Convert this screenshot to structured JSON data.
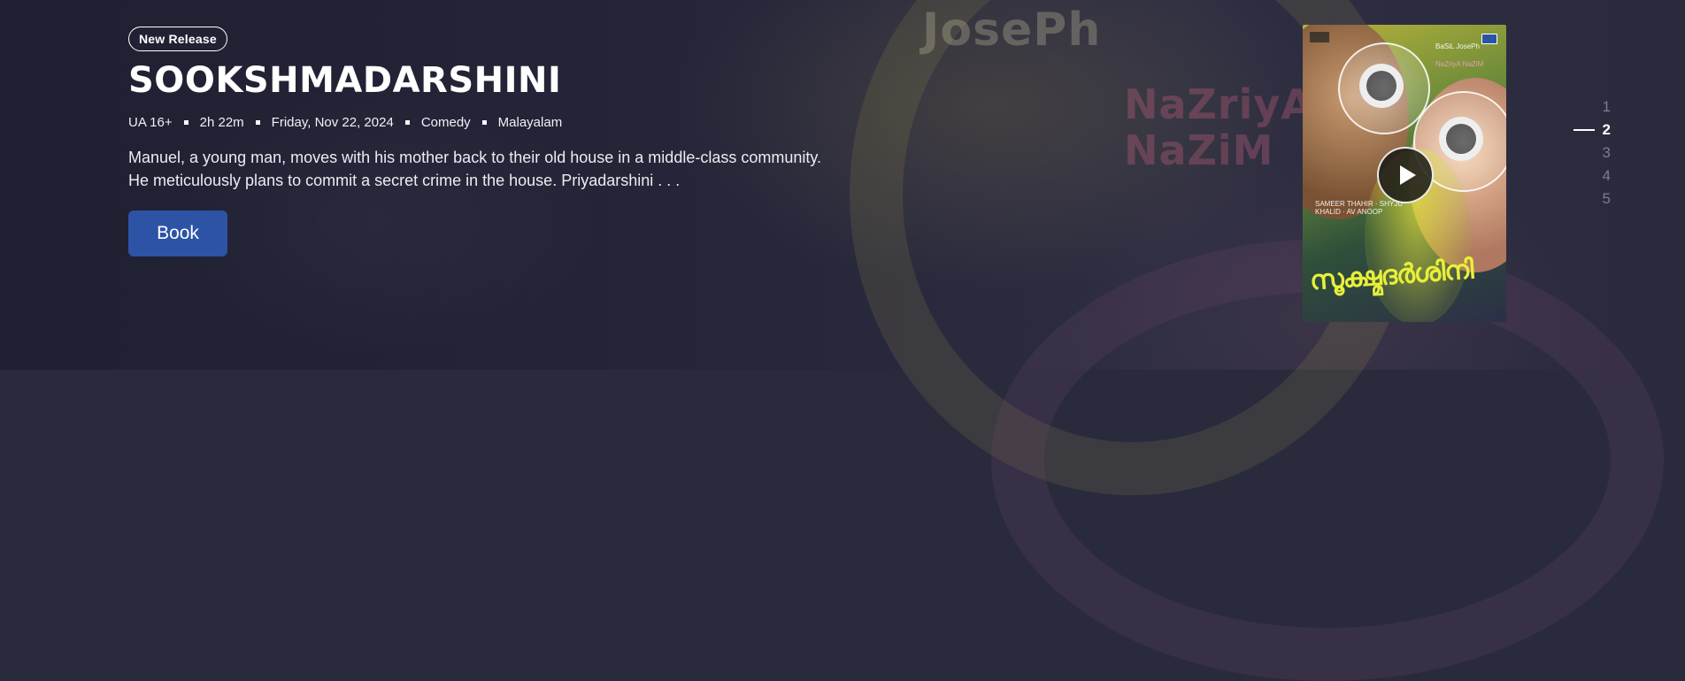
{
  "hero": {
    "badge": "New Release",
    "title": "SOOKSHMADARSHINI",
    "meta": [
      "UA 16+",
      "2h 22m",
      "Friday, Nov 22, 2024",
      "Comedy",
      "Malayalam"
    ],
    "description": "Manuel, a young man, moves with his mother back to their old house in a middle-class community. He meticulously plans to commit a secret crime in the house. Priyadarshini . . .",
    "book_label": "Book"
  },
  "background_text": {
    "word1": "JosePh",
    "word2_line1": "NaZriyA",
    "word2_line2": "NaZiM"
  },
  "poster": {
    "credit1": "BaSiL JosePh",
    "credit2": "NaZriyA NaZiM",
    "credits": "SAMEER THAHIR · SHYJU KHALID · AV ANOOP",
    "malayalam_title": "സൂക്ഷ്മദർശിനി",
    "play_icon": "play-icon"
  },
  "pager": {
    "items": [
      "1",
      "2",
      "3",
      "4",
      "5"
    ],
    "active_index": 1
  },
  "colors": {
    "background": "#2a2a3d",
    "button": "#2c53a6",
    "pager_inactive": "#7d7d90"
  }
}
